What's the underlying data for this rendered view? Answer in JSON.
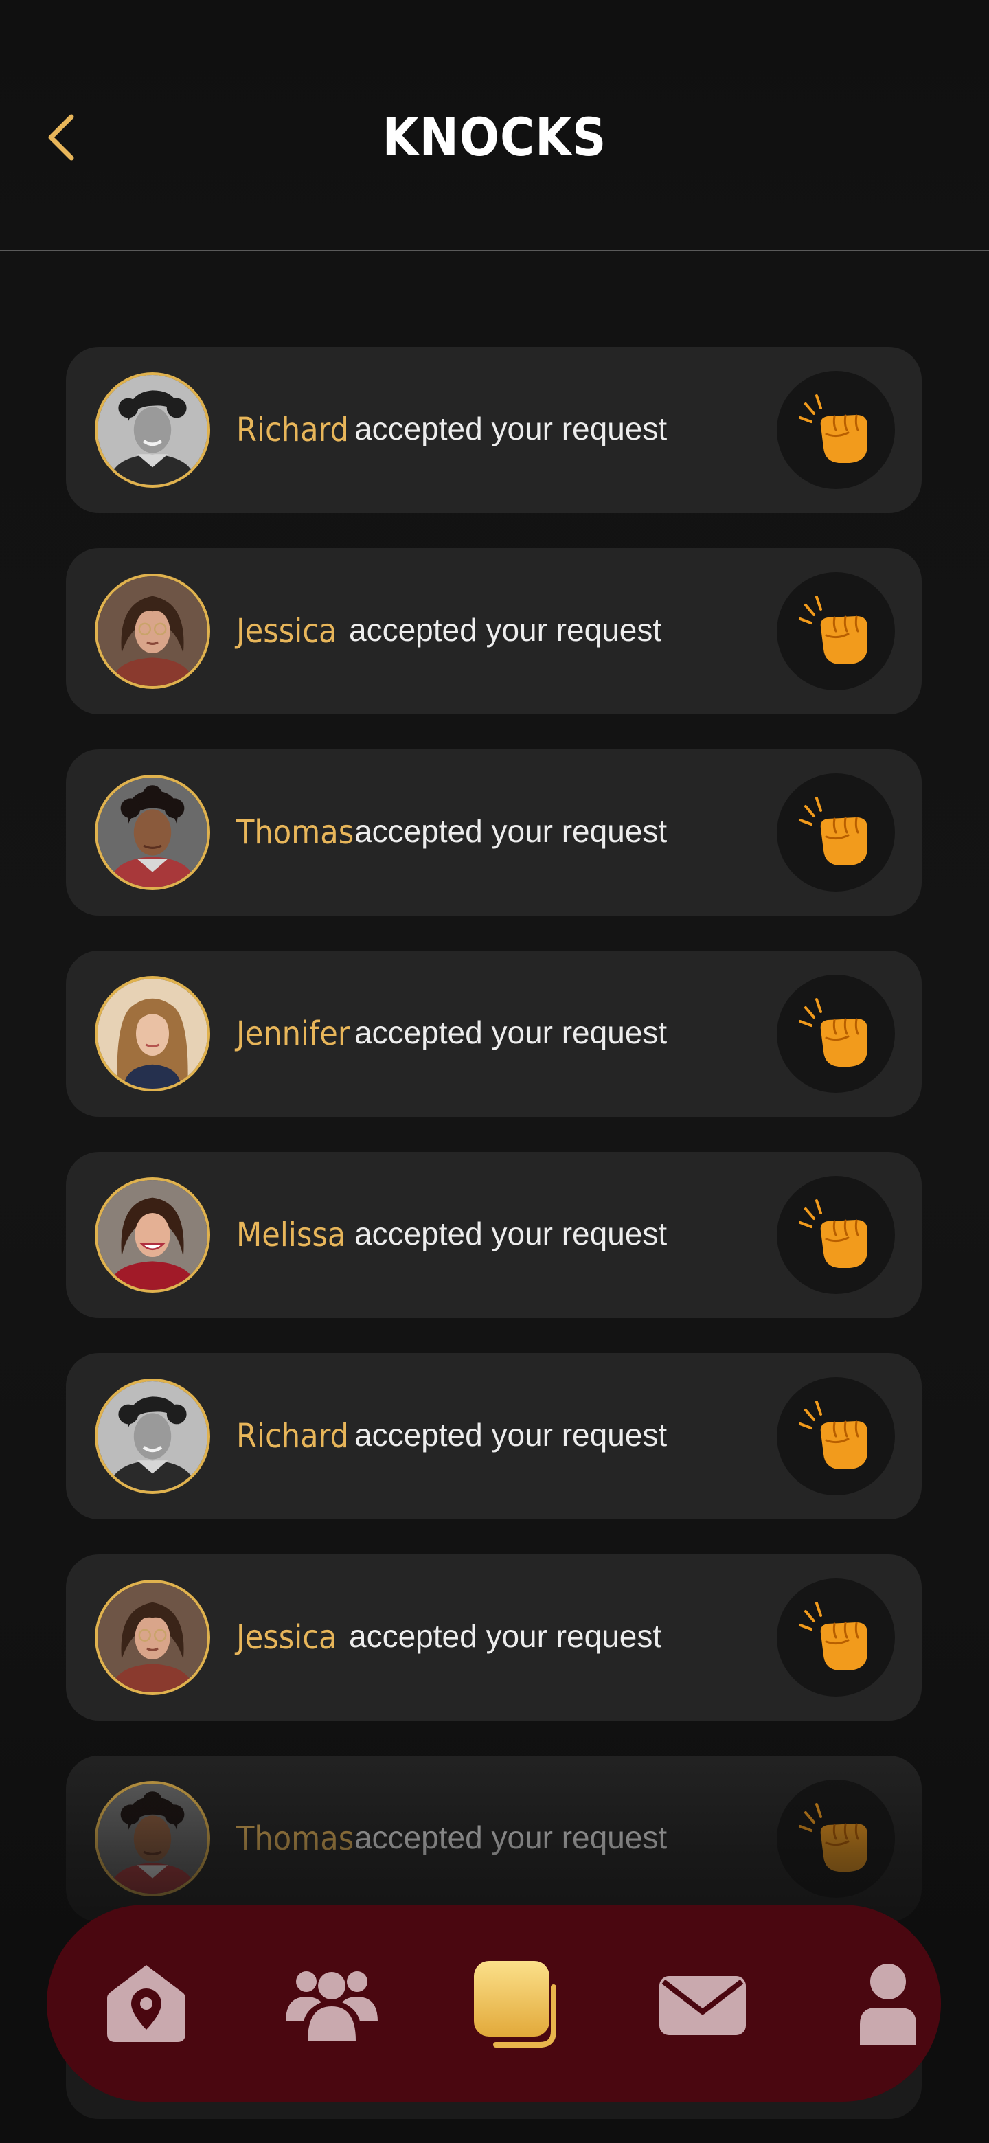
{
  "header": {
    "title": "KNOCKS"
  },
  "knocks": [
    {
      "name": "Richard",
      "message": "accepted your request",
      "avatar": "man-curly-bw"
    },
    {
      "name": "Jessica",
      "message": "accepted your request",
      "avatar": "woman-glasses"
    },
    {
      "name": "Thomas",
      "message": "accepted your request",
      "avatar": "man-curly-dark"
    },
    {
      "name": "Jennifer",
      "message": "accepted your request",
      "avatar": "woman-long-hair"
    },
    {
      "name": "Melissa",
      "message": "accepted your request",
      "avatar": "woman-smiling-red"
    },
    {
      "name": "Richard",
      "message": "accepted your request",
      "avatar": "man-curly-bw"
    },
    {
      "name": "Jessica",
      "message": "accepted your request",
      "avatar": "woman-glasses"
    },
    {
      "name": "Thomas",
      "message": "accepted your request",
      "avatar": "man-curly-dark"
    }
  ],
  "nav": {
    "items": [
      {
        "icon": "home-location-icon",
        "active": false
      },
      {
        "icon": "people-group-icon",
        "active": false
      },
      {
        "icon": "cards-stack-icon",
        "active": true
      },
      {
        "icon": "envelope-icon",
        "active": false
      },
      {
        "icon": "person-icon",
        "active": false
      }
    ]
  },
  "colors": {
    "accent": "#e8b65a",
    "background": "#0e0e0e",
    "card": "#252525",
    "nav_bar": "#4a0710",
    "nav_icon": "#c9a9ae",
    "knock_emoji": "#f29b1c"
  }
}
